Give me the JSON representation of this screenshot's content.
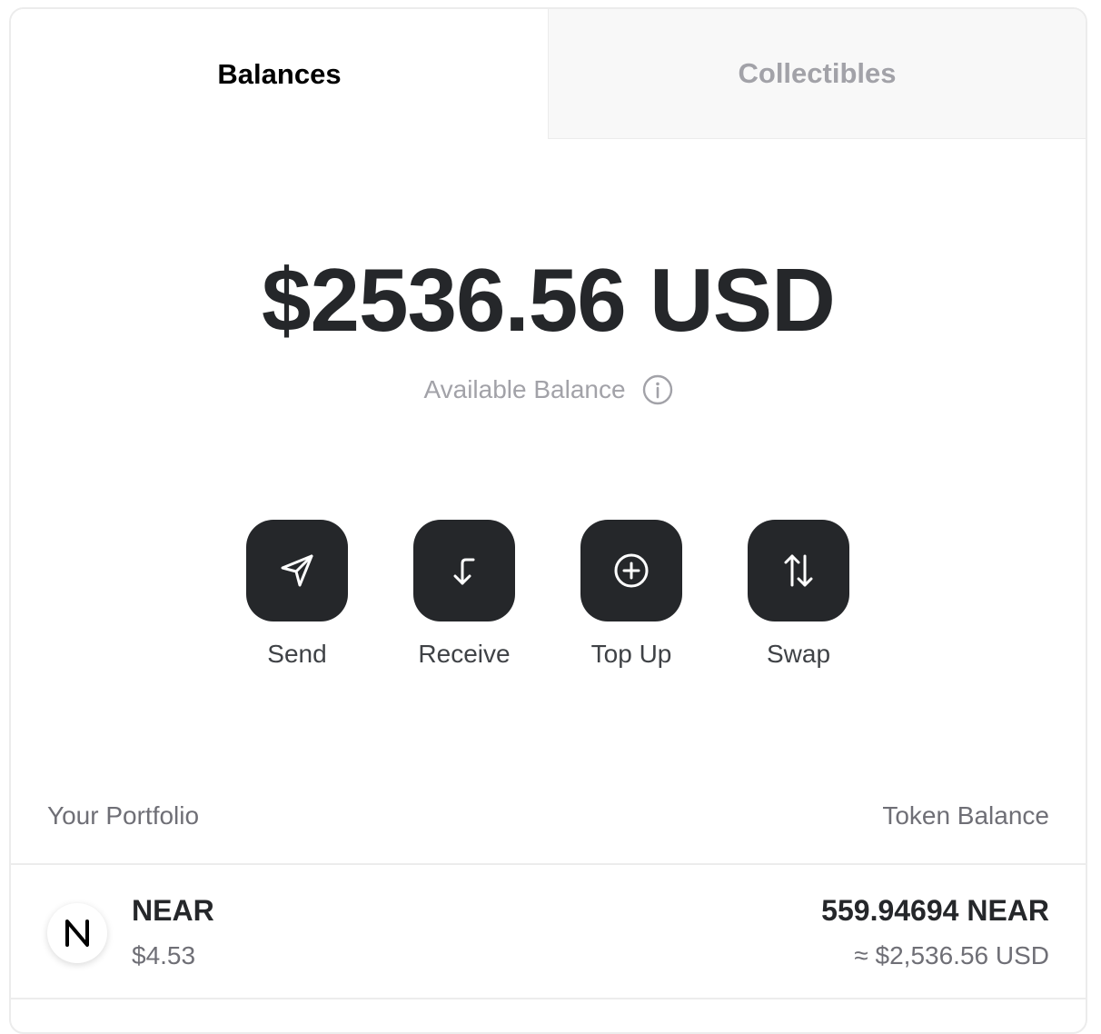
{
  "tabs": [
    {
      "label": "Balances",
      "active": true
    },
    {
      "label": "Collectibles",
      "active": false
    }
  ],
  "balance": {
    "total": "$2536.56 USD",
    "label": "Available Balance",
    "info_icon": "info-icon"
  },
  "actions": [
    {
      "label": "Send",
      "icon": "send-icon"
    },
    {
      "label": "Receive",
      "icon": "receive-icon"
    },
    {
      "label": "Top Up",
      "icon": "plus-circle-icon"
    },
    {
      "label": "Swap",
      "icon": "swap-icon"
    }
  ],
  "portfolio": {
    "left_header": "Your Portfolio",
    "right_header": "Token Balance",
    "tokens": [
      {
        "name": "NEAR",
        "price": "$4.53",
        "amount": "559.94694 NEAR",
        "usd_value": "≈ $2,536.56 USD",
        "icon": "near-logo-icon"
      }
    ]
  },
  "colors": {
    "text_dark": "#25272a",
    "text_muted": "#a2a2a8",
    "text_secondary": "#6f6f76",
    "button_bg": "#25272a",
    "border": "#ececec",
    "inactive_tab_bg": "#f8f8f8"
  }
}
